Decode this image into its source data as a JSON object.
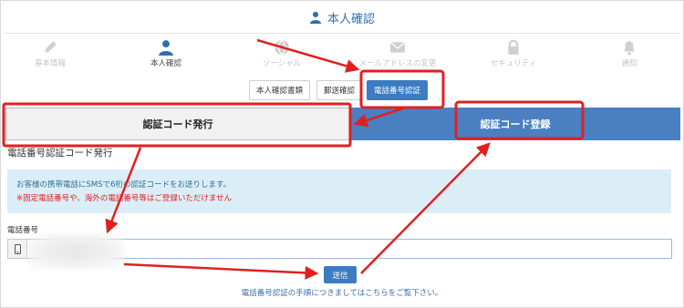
{
  "header": {
    "title": "本人確認",
    "icon": "user-icon"
  },
  "steps": [
    {
      "label": "基本情報",
      "icon": "pencil-icon",
      "active": false
    },
    {
      "label": "本人確認",
      "icon": "user-icon",
      "active": true
    },
    {
      "label": "ソーシャル",
      "icon": "globe-icon",
      "active": false
    },
    {
      "label": "メールアドレスの変更",
      "icon": "envelope-icon",
      "active": false
    },
    {
      "label": "セキュリティ",
      "icon": "lock-icon",
      "active": false
    },
    {
      "label": "通知",
      "icon": "bell-icon",
      "active": false
    }
  ],
  "subtabs": [
    {
      "label": "本人確認書類",
      "active": false
    },
    {
      "label": "郵送確認",
      "active": false
    },
    {
      "label": "電話番号認証",
      "active": true
    }
  ],
  "bigtabs": {
    "issue": "認証コード発行",
    "register": "認証コード登録"
  },
  "section_title": "電話番号認証コード発行",
  "info": {
    "line1": "お客様の携帯電話にSMSで6桁の認証コードをお送りします。",
    "line2": "※固定電話番号や、海外の電話番号等はご登録いただけません"
  },
  "phone": {
    "label": "電話番号",
    "value": "",
    "icon": "mobile-icon"
  },
  "send_label": "送信",
  "help_text": "電話番号認証の手順につきましてはこちらをご覧下さい。",
  "colors": {
    "accent": "#3b7cc2",
    "annotation": "#e02020",
    "info_bg": "#dbeef7"
  }
}
